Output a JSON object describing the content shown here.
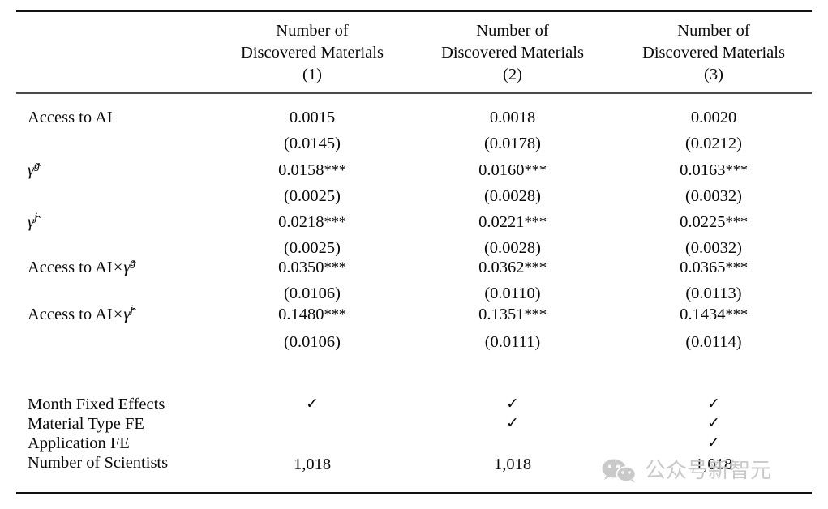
{
  "table": {
    "header": {
      "row_label_header": "",
      "columns": [
        {
          "line1": "Number of",
          "line2": "Discovered Materials",
          "line3": "(1)"
        },
        {
          "line1": "Number of",
          "line2": "Discovered Materials",
          "line3": "(2)"
        },
        {
          "line1": "Number of",
          "line2": "Discovered Materials",
          "line3": "(3)"
        }
      ]
    },
    "coefficient_rows": [
      {
        "label_plain": "Access to AI",
        "estimates": [
          "0.0015",
          "0.0018",
          "0.0020"
        ],
        "stars": [
          "",
          "",
          ""
        ],
        "std_errors": [
          "(0.0145)",
          "(0.0178)",
          "(0.0212)"
        ]
      },
      {
        "label_plain": "gamma-hat^g",
        "estimates": [
          "0.0158",
          "0.0160",
          "0.0163"
        ],
        "stars": [
          "***",
          "***",
          "***"
        ],
        "std_errors": [
          "(0.0025)",
          "(0.0028)",
          "(0.0032)"
        ]
      },
      {
        "label_plain": "gamma-hat^j",
        "estimates": [
          "0.0218",
          "0.0221",
          "0.0225"
        ],
        "stars": [
          "***",
          "***",
          "***"
        ],
        "std_errors": [
          "(0.0025)",
          "(0.0028)",
          "(0.0032)"
        ]
      },
      {
        "label_plain": "Access to AI x gamma-hat^g",
        "estimates": [
          "0.0350",
          "0.0362",
          "0.0365"
        ],
        "stars": [
          "***",
          "***",
          "***"
        ],
        "std_errors": [
          "(0.0106)",
          "(0.0110)",
          "(0.0113)"
        ]
      },
      {
        "label_plain": "Access to AI x gamma-hat^j",
        "estimates": [
          "0.1480",
          "0.1351",
          "0.1434"
        ],
        "stars": [
          "***",
          "***",
          "***"
        ],
        "std_errors": [
          "(0.0106)",
          "(0.0111)",
          "(0.0114)"
        ]
      }
    ],
    "label_parts": {
      "access_to_ai": "Access to AI",
      "gamma": "γ̂",
      "sup_g": "g",
      "sup_j": "j",
      "times": "×"
    },
    "footer_rows": [
      {
        "label": "Month Fixed Effects",
        "marks": [
          "✓",
          "✓",
          "✓"
        ]
      },
      {
        "label": "Material Type FE",
        "marks": [
          "",
          "✓",
          "✓"
        ]
      },
      {
        "label": "Application FE",
        "marks": [
          "",
          "",
          "✓"
        ]
      },
      {
        "label": "Number of Scientists",
        "marks": [
          "1,018",
          "1,018",
          "1,018"
        ]
      }
    ]
  },
  "watermark": {
    "logo_name": "wechat-logo-icon",
    "text": "公众号新智元",
    "color": "#c9c9c9"
  },
  "colors": {
    "text": "#0b0b0b",
    "rule_heavy": "#111111",
    "rule_light": "#4a4a4a",
    "background": "#ffffff"
  }
}
